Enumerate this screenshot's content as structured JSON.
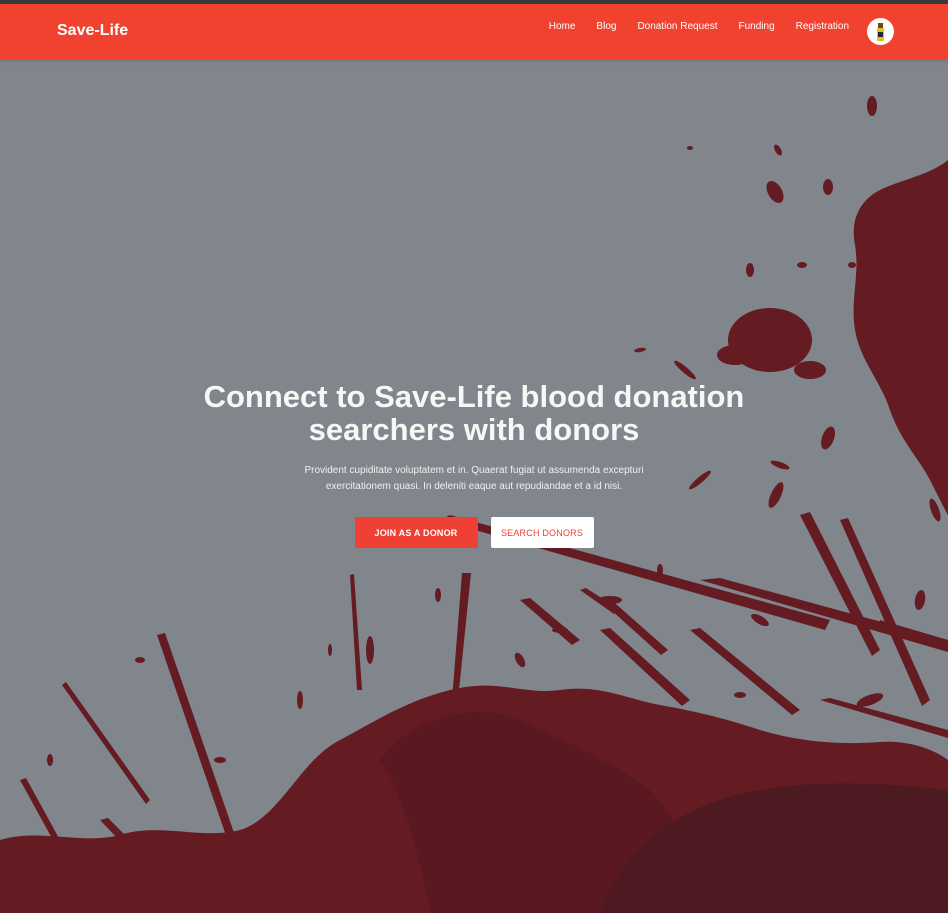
{
  "header": {
    "brand": "Save-Life",
    "nav": [
      "Home",
      "Blog",
      "Donation Request",
      "Funding",
      "Registration"
    ],
    "avatar_icon": "user-avatar-icon"
  },
  "hero": {
    "title_line1": "Connect to Save-Life blood donation",
    "title_line2": "searchers with donors",
    "subtitle_line1": "Provident cupiditate voluptatem et in. Quaerat fugiat ut assumenda excepturi",
    "subtitle_line2": "exercitationem quasi. In deleniti eaque aut repudiandae et a id nisi.",
    "primary_button": "JOIN AS A DONOR",
    "secondary_button": "SEARCH DONORS"
  },
  "colors": {
    "navbar": "#f1412f",
    "background": "#81868c",
    "splatter": "#641b22",
    "accent": "#ee4034"
  }
}
